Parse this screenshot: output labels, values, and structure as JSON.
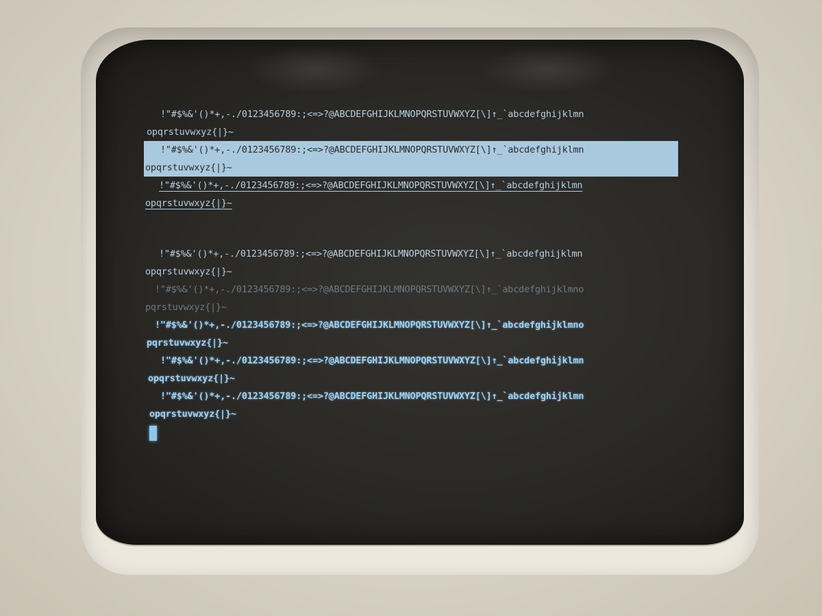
{
  "terminal": {
    "block_normal": [
      "!\"#$%&'()*+,-./0123456789:;<=>?@ABCDEFGHIJKLMNOPQRSTUVWXYZ[\\]↑_`abcdefghijklmn",
      "opqrstuvwxyz{|}~"
    ],
    "block_inverse": [
      "!\"#$%&'()*+,-./0123456789:;<=>?@ABCDEFGHIJKLMNOPQRSTUVWXYZ[\\]↑_`abcdefghijklmn",
      "opqrstuvwxyz{|}~"
    ],
    "block_underline": [
      "!\"#$%&'()*+,-./0123456789:;<=>?@ABCDEFGHIJKLMNOPQRSTUVWXYZ[\\]↑_`abcdefghijklmn",
      "opqrstuvwxyz{|}~"
    ],
    "block_normal_2": [
      "!\"#$%&'()*+,-./0123456789:;<=>?@ABCDEFGHIJKLMNOPQRSTUVWXYZ[\\]↑_`abcdefghijklmn",
      "opqrstuvwxyz{|}~"
    ],
    "block_dim": [
      "!\"#$%&'()*+,-./0123456789:;<=>?@ABCDEFGHIJKLMNOPQRSTUVWXYZ[\\]↑_`abcdefghijklmno",
      "pqrstuvwxyz{|}~"
    ],
    "block_bold_1": [
      "!\"#$%&'()*+,-./0123456789:;<=>?@ABCDEFGHIJKLMNOPQRSTUVWXYZ[\\]↑_`abcdefghijklmno",
      "pqrstuvwxyz{|}~"
    ],
    "block_bold_2": [
      "!\"#$%&'()*+,-./0123456789:;<=>?@ABCDEFGHIJKLMNOPQRSTUVWXYZ[\\]↑_`abcdefghijklmn",
      "opqrstuvwxyz{|}~"
    ],
    "block_bold_3": [
      "!\"#$%&'()*+,-./0123456789:;<=>?@ABCDEFGHIJKLMNOPQRSTUVWXYZ[\\]↑_`abcdefghijklmn",
      "opqrstuvwxyz{|}~"
    ]
  },
  "colors": {
    "phosphor": "#b5cfe0",
    "phosphor_bright": "#9fd1f2",
    "screen_bg": "#2a2926",
    "bezel": "#e6e1d6"
  }
}
